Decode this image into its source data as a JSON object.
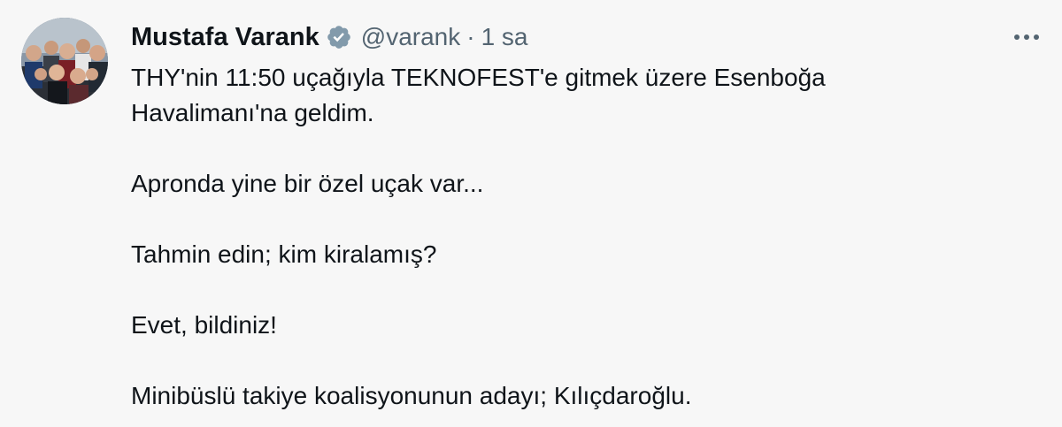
{
  "tweet": {
    "author_name": "Mustafa Varank",
    "handle": "@varank",
    "separator": "·",
    "time": "1 sa",
    "verified_icon": "verified-badge-icon",
    "more_icon": "more-options-icon",
    "colors": {
      "text": "#0f1419",
      "secondary": "#536471",
      "verified_badge": "#829aab",
      "background": "#f7f7f7"
    },
    "lines": [
      "THY'nin 11:50 uçağıyla TEKNOFEST'e gitmek üzere Esenboğa",
      "Havalimanı'na geldim.",
      "Apronda yine bir özel uçak var...",
      "Tahmin edin; kim kiralamış?",
      "Evet, bildiniz!",
      "Minibüslü takiye koalisyonunun adayı; Kılıçdaroğlu."
    ]
  }
}
